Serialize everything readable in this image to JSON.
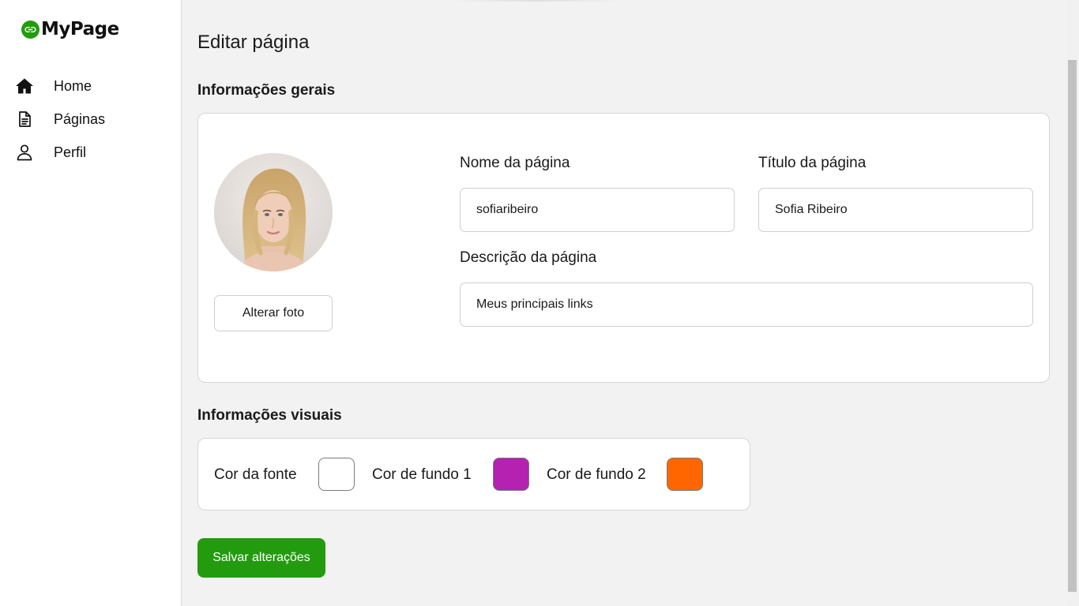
{
  "app": {
    "logo_text": "MyPage",
    "brand_color": "#239b0f"
  },
  "sidebar": {
    "items": [
      {
        "label": "Home",
        "icon": "home-icon"
      },
      {
        "label": "Páginas",
        "icon": "document-icon"
      },
      {
        "label": "Perfil",
        "icon": "person-icon"
      }
    ]
  },
  "main": {
    "page_title": "Editar página",
    "general": {
      "section_title": "Informações gerais",
      "change_photo_label": "Alterar foto",
      "page_name_label": "Nome da página",
      "page_name_value": "sofiaribeiro",
      "page_title_label": "Título da página",
      "page_title_value": "Sofia Ribeiro",
      "description_label": "Descrição da página",
      "description_value": "Meus principais links"
    },
    "visual": {
      "section_title": "Informações visuais",
      "font_color_label": "Cor da fonte",
      "font_color": "#ffffff",
      "bg1_label": "Cor de fundo 1",
      "bg1_color": "#b521b0",
      "bg2_label": "Cor de fundo 2",
      "bg2_color": "#ff6600"
    },
    "save_label": "Salvar alterações"
  }
}
